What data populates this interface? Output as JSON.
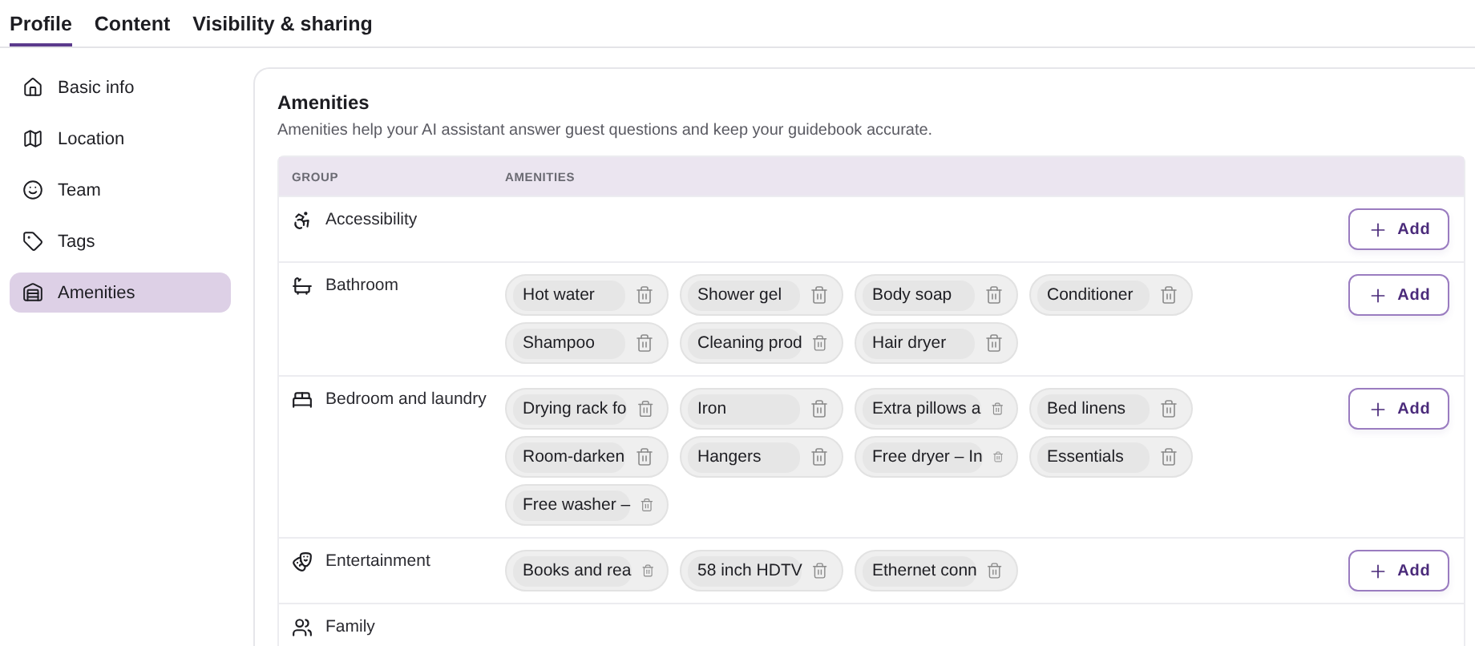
{
  "tabs": [
    {
      "label": "Profile",
      "selected": true
    },
    {
      "label": "Content",
      "selected": false
    },
    {
      "label": "Visibility & sharing",
      "selected": false
    }
  ],
  "sidebar": {
    "items": [
      {
        "label": "Basic info",
        "selected": false
      },
      {
        "label": "Location",
        "selected": false
      },
      {
        "label": "Team",
        "selected": false
      },
      {
        "label": "Tags",
        "selected": false
      },
      {
        "label": "Amenities",
        "selected": true
      }
    ]
  },
  "section": {
    "title": "Amenities",
    "description": "Amenities help your AI assistant answer guest questions and keep your guidebook accurate."
  },
  "table": {
    "columns": [
      "GROUP",
      "AMENITIES"
    ],
    "rows": [
      {
        "group": "Accessibility",
        "amenities": [],
        "add_label": "Add"
      },
      {
        "group": "Bathroom",
        "amenities": [
          "Hot water",
          "Shower gel",
          "Body soap",
          "Conditioner",
          "Shampoo",
          "Cleaning prod",
          "Hair dryer"
        ],
        "add_label": "Add"
      },
      {
        "group": "Bedroom and laundry",
        "amenities": [
          "Drying rack fo",
          "Iron",
          "Extra pillows a",
          "Bed linens",
          "Room-darken",
          "Hangers",
          "Free dryer – In",
          "Essentials",
          "Free washer –"
        ],
        "add_label": "Add"
      },
      {
        "group": "Entertainment",
        "amenities": [
          "Books and rea",
          "58 inch HDTV",
          "Ethernet conn"
        ],
        "add_label": "Add"
      },
      {
        "group": "Family",
        "amenities": []
      }
    ]
  }
}
